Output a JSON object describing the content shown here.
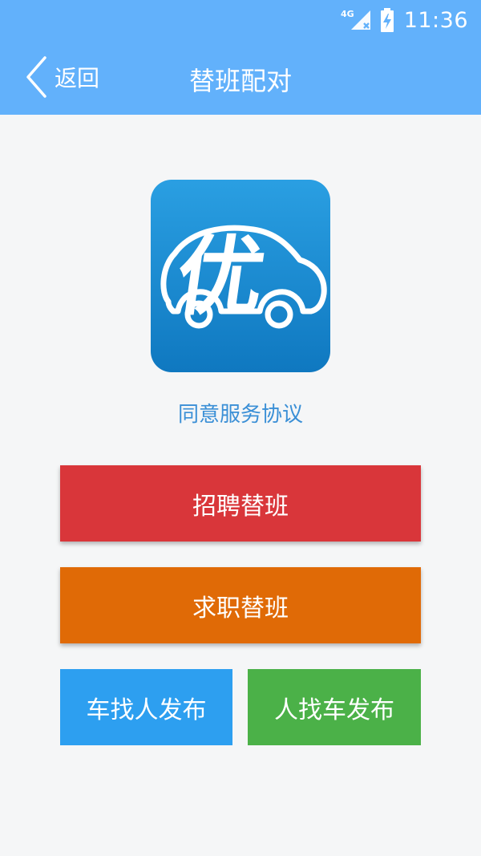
{
  "status_bar": {
    "network": "4G",
    "time": "11:36"
  },
  "nav": {
    "back_label": "返回",
    "title": "替班配对"
  },
  "logo": {
    "glyph": "优",
    "background_top": "#2a9fe2",
    "background_bottom": "#0f78c0"
  },
  "agreement_link": "同意服务协议",
  "buttons": {
    "recruit_substitute": "招聘替班",
    "seek_substitute": "求职替班",
    "car_seeks_person": "车找人发布",
    "person_seeks_car": "人找车发布"
  },
  "colors": {
    "header": "#62b1fb",
    "recruit": "#d9363a",
    "seek": "#e06a06",
    "car_seeks_person": "#2d9ff0",
    "person_seeks_car": "#4bb148",
    "link": "#3a8fd6"
  }
}
